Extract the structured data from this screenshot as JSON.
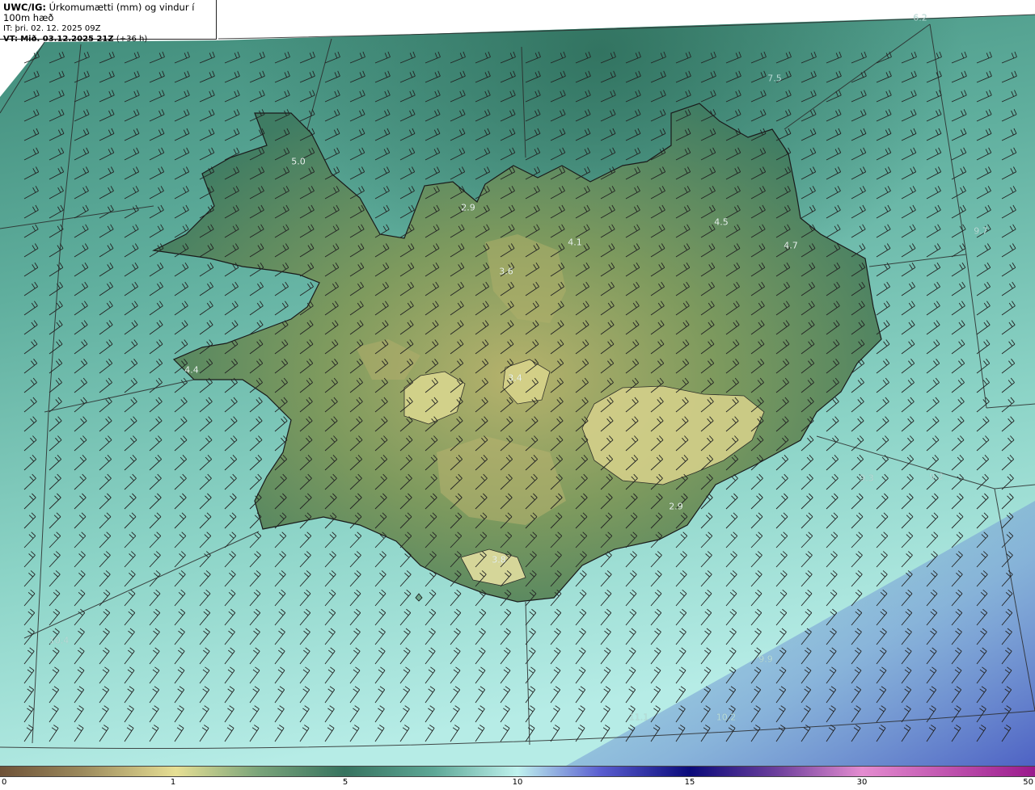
{
  "header": {
    "model_prefix": "UWC/IG:",
    "title": "Úrkomumætti (mm) og vindur í 100m hæð",
    "analysis_time": "IT: þri. 02. 12. 2025 09Z",
    "valid_prefix": "VT:",
    "valid_time": "Mið. 03.12.2025 21Z",
    "valid_offset": "(+36 h)"
  },
  "map_labels": [
    "6.2",
    "7.5",
    "5.0",
    "2.9",
    "3.6",
    "4.1",
    "4.5",
    "4.7",
    "9.7",
    "4.4",
    "3.4",
    "2.9",
    "3.8",
    "9.3",
    "9.2",
    "10.4",
    "9.9",
    "11.1",
    "10.2"
  ],
  "legend": {
    "ticks": [
      "0",
      "1",
      "5",
      "10",
      "15",
      "30",
      "50"
    ],
    "colors": {
      "brown": "#6e5238",
      "olive": "#b8a86a",
      "pale_yellow": "#e6df94",
      "teal_dark": "#37735f",
      "teal_mid": "#5ea897",
      "cyan_light": "#bff2ee",
      "blue": "#3434b0",
      "navy": "#0a0a7a",
      "purple": "#6c3f9c",
      "pink": "#e48cd0",
      "magenta": "#9a1a8c"
    }
  }
}
